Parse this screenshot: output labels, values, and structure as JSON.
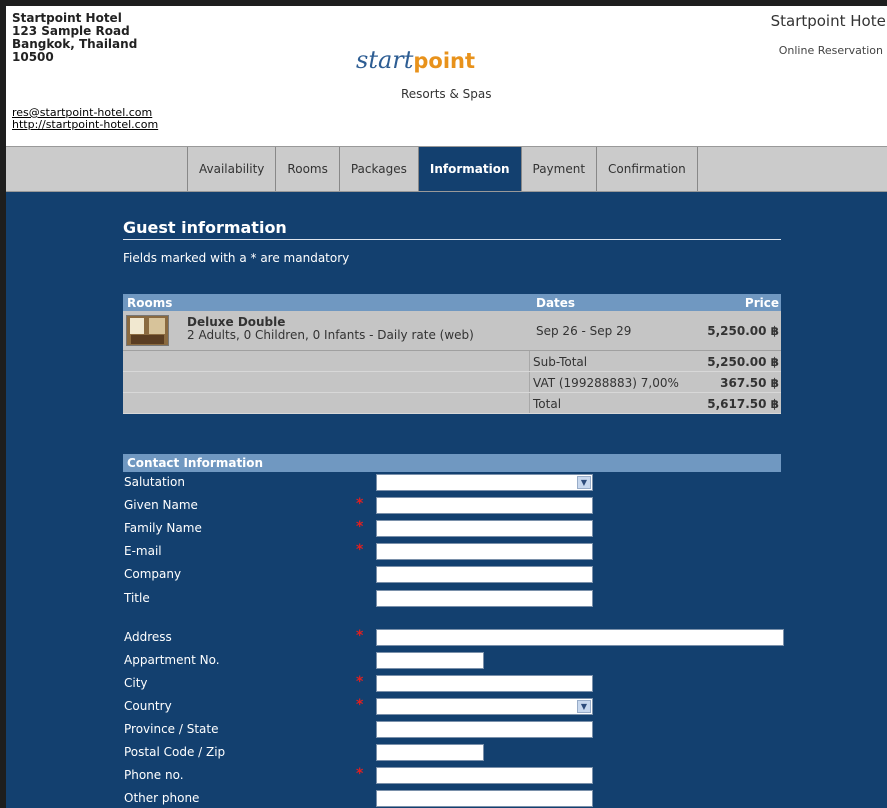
{
  "header": {
    "address_lines": [
      "Startpoint Hotel",
      "123 Sample Road",
      "Bangkok, Thailand",
      "10500"
    ],
    "email": "res@startpoint-hotel.com",
    "website": "http://startpoint-hotel.com",
    "logo_start": "start",
    "logo_point": "point",
    "logo_subtitle": "Resorts & Spas",
    "hotel_name": "Startpoint Hotel",
    "hotel_subtitle": "Online Reservation"
  },
  "nav": {
    "tabs": [
      "Availability",
      "Rooms",
      "Packages",
      "Information",
      "Payment",
      "Confirmation"
    ],
    "active": "Information"
  },
  "main": {
    "section_title": "Guest information",
    "note": "Fields marked with a * are mandatory",
    "rooms_table": {
      "headers": {
        "rooms": "Rooms",
        "dates": "Dates",
        "price": "Price"
      },
      "room": {
        "name": "Deluxe Double",
        "desc": "2 Adults, 0 Children, 0 Infants - Daily rate (web)",
        "dates": "Sep 26 - Sep 29",
        "price": "5,250.00 ฿"
      },
      "subtotal_label": "Sub-Total",
      "subtotal_value": "5,250.00 ฿",
      "vat_label": "VAT (199288883) 7,00%",
      "vat_value": "367.50 ฿",
      "total_label": "Total",
      "total_value": "5,617.50 ฿"
    },
    "contact": {
      "title": "Contact Information",
      "fields": [
        {
          "label": "Salutation",
          "required": false,
          "type": "select",
          "value": ""
        },
        {
          "label": "Given Name",
          "required": true,
          "type": "text",
          "value": ""
        },
        {
          "label": "Family Name",
          "required": true,
          "type": "text",
          "value": ""
        },
        {
          "label": "E-mail",
          "required": true,
          "type": "text",
          "value": ""
        },
        {
          "label": "Company",
          "required": false,
          "type": "text",
          "value": ""
        },
        {
          "label": "Title",
          "required": false,
          "type": "text",
          "value": ""
        },
        {
          "label": "Address",
          "required": true,
          "type": "text",
          "value": ""
        },
        {
          "label": "Appartment No.",
          "required": false,
          "type": "text",
          "value": ""
        },
        {
          "label": "City",
          "required": true,
          "type": "text",
          "value": ""
        },
        {
          "label": "Country",
          "required": true,
          "type": "select",
          "value": ""
        },
        {
          "label": "Province / State",
          "required": false,
          "type": "text",
          "value": ""
        },
        {
          "label": "Postal Code / Zip",
          "required": false,
          "type": "text",
          "value": ""
        },
        {
          "label": "Phone no.",
          "required": true,
          "type": "text",
          "value": ""
        },
        {
          "label": "Other phone",
          "required": false,
          "type": "text",
          "value": ""
        }
      ],
      "required_marker": "*"
    }
  },
  "colors": {
    "main_bg": "#13406f",
    "table_header": "#7098c1",
    "nav_bg": "#cbcbcb",
    "required": "#e02020",
    "logo_blue": "#2d5d93",
    "logo_orange": "#e8921b"
  },
  "icons": {
    "select_arrow": "chevron-down-icon"
  }
}
